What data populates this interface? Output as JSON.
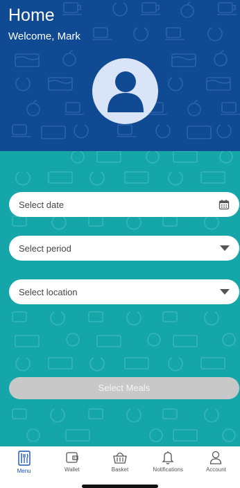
{
  "header": {
    "title": "Home",
    "welcome": "Welcome, Mark",
    "avatar_icon": "user-icon"
  },
  "form": {
    "date": {
      "placeholder": "Select date",
      "icon": "calendar-icon"
    },
    "period": {
      "placeholder": "Select period",
      "icon": "chevron-down-icon"
    },
    "location": {
      "placeholder": "Select location",
      "icon": "chevron-down-icon"
    },
    "submit_label": "Select Meals"
  },
  "tabbar": {
    "items": [
      {
        "label": "Menu",
        "icon": "menu-book-icon",
        "active": true
      },
      {
        "label": "Wallet",
        "icon": "wallet-icon",
        "active": false
      },
      {
        "label": "Basket",
        "icon": "basket-icon",
        "active": false
      },
      {
        "label": "Notifications",
        "icon": "bell-icon",
        "active": false
      },
      {
        "label": "Account",
        "icon": "person-icon",
        "active": false
      }
    ]
  },
  "colors": {
    "header_bg": "#0f4a93",
    "body_bg": "#14a6a8",
    "avatar_bg": "#d9e4f7",
    "avatar_icon": "#0f4a93",
    "active_tab": "#1552b3",
    "disabled_button": "#c8c8c8"
  }
}
